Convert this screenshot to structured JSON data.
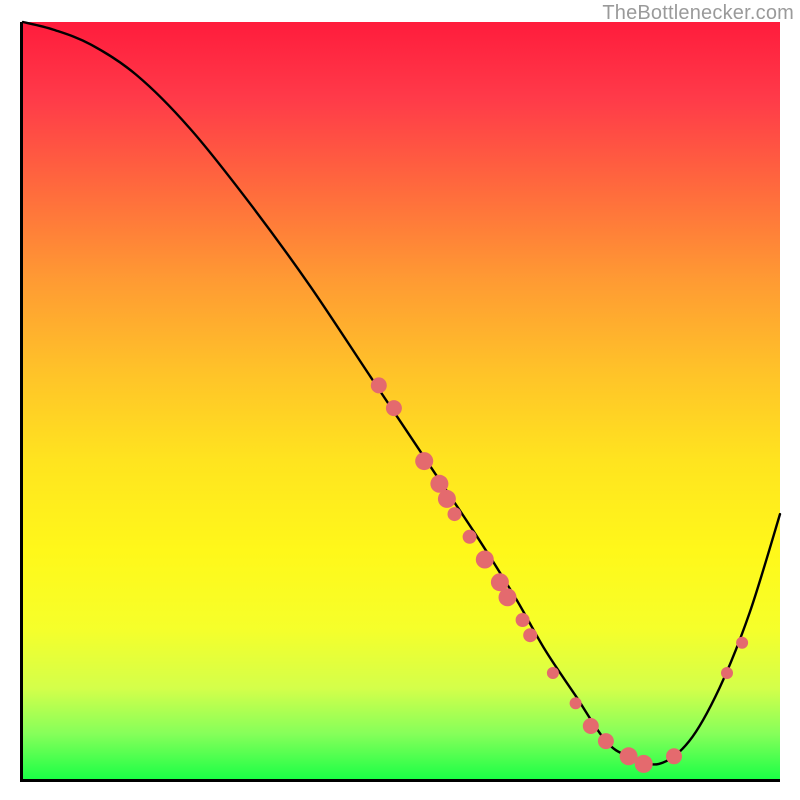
{
  "watermark": {
    "text": "TheBottlenecker.com"
  },
  "chart_data": {
    "type": "line",
    "title": "",
    "xlabel": "",
    "ylabel": "",
    "xlim": [
      0,
      100
    ],
    "ylim": [
      0,
      100
    ],
    "grid": false,
    "legend": false,
    "background_gradient": [
      "#ff1c3c",
      "#ffe41f",
      "#1bff46"
    ],
    "series": [
      {
        "name": "bottleneck-curve",
        "x": [
          0,
          4,
          9,
          15,
          22,
          30,
          38,
          46,
          54,
          60,
          65,
          69,
          73,
          77,
          80,
          84,
          88,
          92,
          96,
          100
        ],
        "y": [
          100,
          99,
          97,
          93,
          86,
          76,
          65,
          53,
          41,
          32,
          24,
          17,
          11,
          5,
          3,
          2,
          5,
          12,
          22,
          35
        ]
      }
    ],
    "markers": {
      "name": "highlight-points",
      "color": "#e46a6e",
      "points": [
        {
          "x": 47,
          "y": 52,
          "r": 8
        },
        {
          "x": 49,
          "y": 49,
          "r": 8
        },
        {
          "x": 53,
          "y": 42,
          "r": 9
        },
        {
          "x": 55,
          "y": 39,
          "r": 9
        },
        {
          "x": 56,
          "y": 37,
          "r": 9
        },
        {
          "x": 57,
          "y": 35,
          "r": 7
        },
        {
          "x": 59,
          "y": 32,
          "r": 7
        },
        {
          "x": 61,
          "y": 29,
          "r": 9
        },
        {
          "x": 63,
          "y": 26,
          "r": 9
        },
        {
          "x": 64,
          "y": 24,
          "r": 9
        },
        {
          "x": 66,
          "y": 21,
          "r": 7
        },
        {
          "x": 67,
          "y": 19,
          "r": 7
        },
        {
          "x": 70,
          "y": 14,
          "r": 6
        },
        {
          "x": 73,
          "y": 10,
          "r": 6
        },
        {
          "x": 75,
          "y": 7,
          "r": 8
        },
        {
          "x": 77,
          "y": 5,
          "r": 8
        },
        {
          "x": 80,
          "y": 3,
          "r": 9
        },
        {
          "x": 82,
          "y": 2,
          "r": 9
        },
        {
          "x": 86,
          "y": 3,
          "r": 8
        },
        {
          "x": 93,
          "y": 14,
          "r": 6
        },
        {
          "x": 95,
          "y": 18,
          "r": 6
        }
      ]
    }
  }
}
